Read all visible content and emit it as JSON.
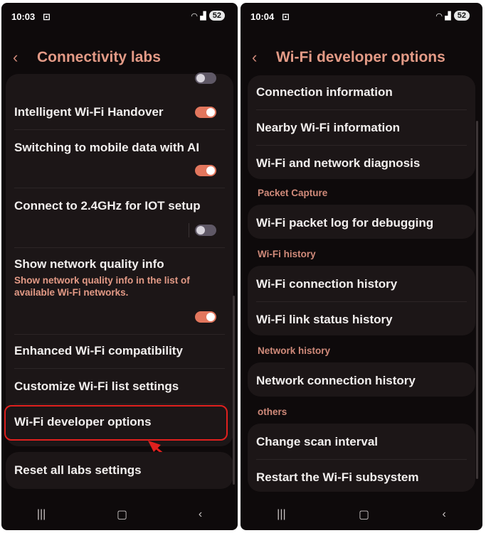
{
  "left": {
    "status": {
      "time": "10:03",
      "battery": "52"
    },
    "title": "Connectivity labs",
    "items": [
      {
        "label": "Intelligent Wi-Fi Handover"
      },
      {
        "label": "Switching to mobile data with AI"
      },
      {
        "label": "Connect to 2.4GHz for IOT setup"
      },
      {
        "label": "Show network quality info",
        "description": "Show network quality info in the list of available Wi-Fi networks."
      },
      {
        "label": "Enhanced Wi-Fi compatibility"
      },
      {
        "label": "Customize Wi-Fi list settings"
      },
      {
        "label": "Wi-Fi developer options"
      },
      {
        "label": "Reset all labs settings"
      }
    ],
    "toggles": {
      "top_partial": "off",
      "handover": "on",
      "mobile_data_ai": "on",
      "iot_24ghz": "off",
      "network_quality": "on"
    }
  },
  "right": {
    "status": {
      "time": "10:04",
      "battery": "52"
    },
    "title": "Wi-Fi developer options",
    "group1": [
      "Connection information",
      "Nearby Wi-Fi information",
      "Wi-Fi and network diagnosis"
    ],
    "header_packet": "Packet Capture",
    "packet_items": [
      "Wi-Fi packet log for debugging"
    ],
    "header_wifi_history": "Wi-Fi history",
    "wifi_history_items": [
      "Wi-Fi connection history",
      "Wi-Fi link status history"
    ],
    "header_network_history": "Network history",
    "network_history_items": [
      "Network connection history"
    ],
    "header_others": "others",
    "others_items": [
      "Change scan interval",
      "Restart the Wi-Fi subsystem"
    ]
  },
  "colors": {
    "accent": "#e39a86",
    "highlight": "#e0201e",
    "toggle_on": "#e2765d"
  },
  "icons": {
    "back": "chevron-left-icon",
    "nav_recents": "recents-icon",
    "nav_home": "home-icon",
    "nav_back": "back-icon"
  }
}
